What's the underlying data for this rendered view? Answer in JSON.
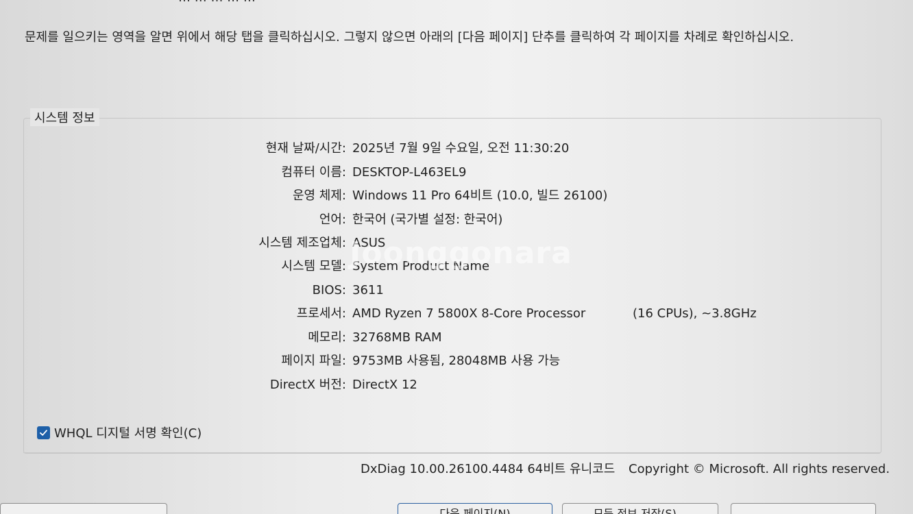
{
  "top_cut_text": "… … … … …",
  "intro_text": "문제를 일으키는 영역을 알면 위에서 해당 탭을 클릭하십시오. 그렇지 않으면 아래의 [다음 페이지] 단추를 클릭하여 각 페이지를 차례로 확인하십시오.",
  "system_info": {
    "title": "시스템 정보",
    "rows": [
      {
        "label": "현재 날짜/시간:",
        "value": "2025년 7월 9일 수요일, 오전 11:30:20"
      },
      {
        "label": "컴퓨터 이름:",
        "value": "DESKTOP-L463EL9"
      },
      {
        "label": "운영 체제:",
        "value": "Windows 11 Pro 64비트 (10.0, 빌드 26100)"
      },
      {
        "label": "언어:",
        "value": "한국어 (국가별 설정: 한국어)"
      },
      {
        "label": "시스템 제조업체:",
        "value": "ASUS"
      },
      {
        "label": "시스템 모델:",
        "value": "System Product Name"
      },
      {
        "label": "BIOS:",
        "value": "3611"
      },
      {
        "label": "프로세서:",
        "value": "AMD Ryzen 7 5800X 8-Core Processor",
        "extra": "(16 CPUs), ~3.8GHz"
      },
      {
        "label": "메모리:",
        "value": "32768MB RAM"
      },
      {
        "label": "페이지 파일:",
        "value": "9753MB 사용됨, 28048MB 사용 가능"
      },
      {
        "label": "DirectX 버전:",
        "value": "DirectX 12"
      }
    ]
  },
  "watermark": "Joonggonara",
  "whql": {
    "label": "WHQL 디지털 서명 확인(C)",
    "checked": true
  },
  "footer": {
    "version": "DxDiag 10.00.26100.4484 64비트 유니코드",
    "copyright": "Copyright © Microsoft. All rights reserved."
  },
  "buttons": {
    "help": "",
    "next_page": "다음 페이지(N)",
    "save_all": "모든 정보 저장(S)...",
    "exit": ""
  },
  "colors": {
    "checkbox": "#1d5fa8",
    "background": "#ececec"
  }
}
